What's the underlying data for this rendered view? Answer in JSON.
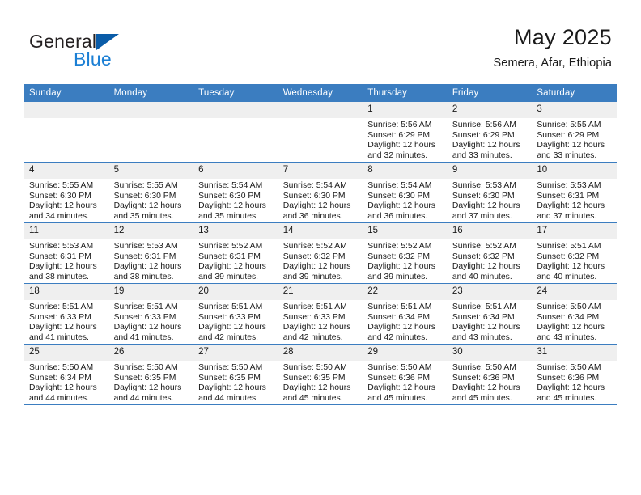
{
  "brand": {
    "name_top": "General",
    "name_bottom": "Blue",
    "triangle_color": "#0a5ca8",
    "blue_color": "#1b7fd4"
  },
  "header": {
    "month_title": "May 2025",
    "location": "Semera, Afar, Ethiopia"
  },
  "theme": {
    "header_blue": "#3b7dc0",
    "daynum_gray": "#efefef",
    "text": "#1a1a1a"
  },
  "weekdays": [
    "Sunday",
    "Monday",
    "Tuesday",
    "Wednesday",
    "Thursday",
    "Friday",
    "Saturday"
  ],
  "labels": {
    "sunrise_prefix": "Sunrise:",
    "sunset_prefix": "Sunset:",
    "daylight_prefix": "Daylight:"
  },
  "weeks": [
    [
      {
        "day": "",
        "empty": true,
        "line1": "",
        "line2": "",
        "line3": "",
        "line4": ""
      },
      {
        "day": "",
        "empty": true,
        "line1": "",
        "line2": "",
        "line3": "",
        "line4": ""
      },
      {
        "day": "",
        "empty": true,
        "line1": "",
        "line2": "",
        "line3": "",
        "line4": ""
      },
      {
        "day": "",
        "empty": true,
        "line1": "",
        "line2": "",
        "line3": "",
        "line4": ""
      },
      {
        "day": "1",
        "empty": false,
        "line1": "Sunrise: 5:56 AM",
        "line2": "Sunset: 6:29 PM",
        "line3": "Daylight: 12 hours",
        "line4": "and 32 minutes."
      },
      {
        "day": "2",
        "empty": false,
        "line1": "Sunrise: 5:56 AM",
        "line2": "Sunset: 6:29 PM",
        "line3": "Daylight: 12 hours",
        "line4": "and 33 minutes."
      },
      {
        "day": "3",
        "empty": false,
        "line1": "Sunrise: 5:55 AM",
        "line2": "Sunset: 6:29 PM",
        "line3": "Daylight: 12 hours",
        "line4": "and 33 minutes."
      }
    ],
    [
      {
        "day": "4",
        "empty": false,
        "line1": "Sunrise: 5:55 AM",
        "line2": "Sunset: 6:30 PM",
        "line3": "Daylight: 12 hours",
        "line4": "and 34 minutes."
      },
      {
        "day": "5",
        "empty": false,
        "line1": "Sunrise: 5:55 AM",
        "line2": "Sunset: 6:30 PM",
        "line3": "Daylight: 12 hours",
        "line4": "and 35 minutes."
      },
      {
        "day": "6",
        "empty": false,
        "line1": "Sunrise: 5:54 AM",
        "line2": "Sunset: 6:30 PM",
        "line3": "Daylight: 12 hours",
        "line4": "and 35 minutes."
      },
      {
        "day": "7",
        "empty": false,
        "line1": "Sunrise: 5:54 AM",
        "line2": "Sunset: 6:30 PM",
        "line3": "Daylight: 12 hours",
        "line4": "and 36 minutes."
      },
      {
        "day": "8",
        "empty": false,
        "line1": "Sunrise: 5:54 AM",
        "line2": "Sunset: 6:30 PM",
        "line3": "Daylight: 12 hours",
        "line4": "and 36 minutes."
      },
      {
        "day": "9",
        "empty": false,
        "line1": "Sunrise: 5:53 AM",
        "line2": "Sunset: 6:30 PM",
        "line3": "Daylight: 12 hours",
        "line4": "and 37 minutes."
      },
      {
        "day": "10",
        "empty": false,
        "line1": "Sunrise: 5:53 AM",
        "line2": "Sunset: 6:31 PM",
        "line3": "Daylight: 12 hours",
        "line4": "and 37 minutes."
      }
    ],
    [
      {
        "day": "11",
        "empty": false,
        "line1": "Sunrise: 5:53 AM",
        "line2": "Sunset: 6:31 PM",
        "line3": "Daylight: 12 hours",
        "line4": "and 38 minutes."
      },
      {
        "day": "12",
        "empty": false,
        "line1": "Sunrise: 5:53 AM",
        "line2": "Sunset: 6:31 PM",
        "line3": "Daylight: 12 hours",
        "line4": "and 38 minutes."
      },
      {
        "day": "13",
        "empty": false,
        "line1": "Sunrise: 5:52 AM",
        "line2": "Sunset: 6:31 PM",
        "line3": "Daylight: 12 hours",
        "line4": "and 39 minutes."
      },
      {
        "day": "14",
        "empty": false,
        "line1": "Sunrise: 5:52 AM",
        "line2": "Sunset: 6:32 PM",
        "line3": "Daylight: 12 hours",
        "line4": "and 39 minutes."
      },
      {
        "day": "15",
        "empty": false,
        "line1": "Sunrise: 5:52 AM",
        "line2": "Sunset: 6:32 PM",
        "line3": "Daylight: 12 hours",
        "line4": "and 39 minutes."
      },
      {
        "day": "16",
        "empty": false,
        "line1": "Sunrise: 5:52 AM",
        "line2": "Sunset: 6:32 PM",
        "line3": "Daylight: 12 hours",
        "line4": "and 40 minutes."
      },
      {
        "day": "17",
        "empty": false,
        "line1": "Sunrise: 5:51 AM",
        "line2": "Sunset: 6:32 PM",
        "line3": "Daylight: 12 hours",
        "line4": "and 40 minutes."
      }
    ],
    [
      {
        "day": "18",
        "empty": false,
        "line1": "Sunrise: 5:51 AM",
        "line2": "Sunset: 6:33 PM",
        "line3": "Daylight: 12 hours",
        "line4": "and 41 minutes."
      },
      {
        "day": "19",
        "empty": false,
        "line1": "Sunrise: 5:51 AM",
        "line2": "Sunset: 6:33 PM",
        "line3": "Daylight: 12 hours",
        "line4": "and 41 minutes."
      },
      {
        "day": "20",
        "empty": false,
        "line1": "Sunrise: 5:51 AM",
        "line2": "Sunset: 6:33 PM",
        "line3": "Daylight: 12 hours",
        "line4": "and 42 minutes."
      },
      {
        "day": "21",
        "empty": false,
        "line1": "Sunrise: 5:51 AM",
        "line2": "Sunset: 6:33 PM",
        "line3": "Daylight: 12 hours",
        "line4": "and 42 minutes."
      },
      {
        "day": "22",
        "empty": false,
        "line1": "Sunrise: 5:51 AM",
        "line2": "Sunset: 6:34 PM",
        "line3": "Daylight: 12 hours",
        "line4": "and 42 minutes."
      },
      {
        "day": "23",
        "empty": false,
        "line1": "Sunrise: 5:51 AM",
        "line2": "Sunset: 6:34 PM",
        "line3": "Daylight: 12 hours",
        "line4": "and 43 minutes."
      },
      {
        "day": "24",
        "empty": false,
        "line1": "Sunrise: 5:50 AM",
        "line2": "Sunset: 6:34 PM",
        "line3": "Daylight: 12 hours",
        "line4": "and 43 minutes."
      }
    ],
    [
      {
        "day": "25",
        "empty": false,
        "line1": "Sunrise: 5:50 AM",
        "line2": "Sunset: 6:34 PM",
        "line3": "Daylight: 12 hours",
        "line4": "and 44 minutes."
      },
      {
        "day": "26",
        "empty": false,
        "line1": "Sunrise: 5:50 AM",
        "line2": "Sunset: 6:35 PM",
        "line3": "Daylight: 12 hours",
        "line4": "and 44 minutes."
      },
      {
        "day": "27",
        "empty": false,
        "line1": "Sunrise: 5:50 AM",
        "line2": "Sunset: 6:35 PM",
        "line3": "Daylight: 12 hours",
        "line4": "and 44 minutes."
      },
      {
        "day": "28",
        "empty": false,
        "line1": "Sunrise: 5:50 AM",
        "line2": "Sunset: 6:35 PM",
        "line3": "Daylight: 12 hours",
        "line4": "and 45 minutes."
      },
      {
        "day": "29",
        "empty": false,
        "line1": "Sunrise: 5:50 AM",
        "line2": "Sunset: 6:36 PM",
        "line3": "Daylight: 12 hours",
        "line4": "and 45 minutes."
      },
      {
        "day": "30",
        "empty": false,
        "line1": "Sunrise: 5:50 AM",
        "line2": "Sunset: 6:36 PM",
        "line3": "Daylight: 12 hours",
        "line4": "and 45 minutes."
      },
      {
        "day": "31",
        "empty": false,
        "line1": "Sunrise: 5:50 AM",
        "line2": "Sunset: 6:36 PM",
        "line3": "Daylight: 12 hours",
        "line4": "and 45 minutes."
      }
    ]
  ]
}
